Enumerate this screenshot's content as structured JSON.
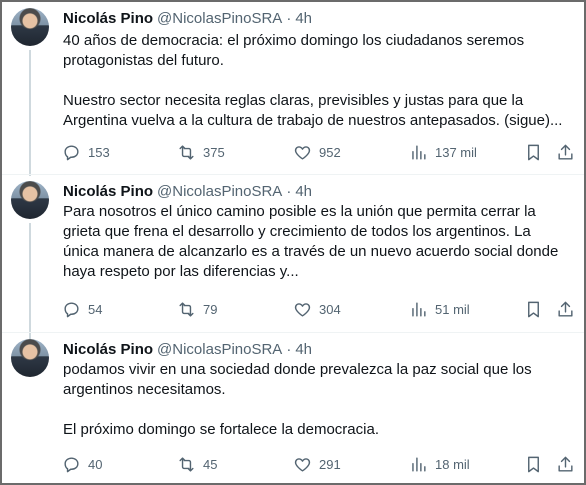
{
  "tweets": [
    {
      "author": {
        "name": "Nicolás Pino",
        "handle": "@NicolasPinoSRA"
      },
      "time": "4h",
      "paragraphs": [
        "40 años de democracia: el próximo domingo los ciudadanos seremos protagonistas del futuro.",
        "Nuestro sector necesita reglas claras, previsibles y justas para que la Argentina vuelva a la cultura de trabajo de nuestros antepasados. (sigue)..."
      ],
      "stats": {
        "replies": "153",
        "retweets": "375",
        "likes": "952",
        "views": "137 mil"
      }
    },
    {
      "author": {
        "name": "Nicolás Pino",
        "handle": "@NicolasPinoSRA"
      },
      "time": "4h",
      "paragraphs": [
        "Para nosotros el único camino posible es la unión que permita cerrar la grieta que frena el desarrollo y crecimiento de todos los argentinos. La única manera de alcanzarlo es a través de un nuevo acuerdo social donde haya respeto por las diferencias y..."
      ],
      "stats": {
        "replies": "54",
        "retweets": "79",
        "likes": "304",
        "views": "51 mil"
      }
    },
    {
      "author": {
        "name": "Nicolás Pino",
        "handle": "@NicolasPinoSRA"
      },
      "time": "4h",
      "paragraphs": [
        "podamos vivir en una sociedad donde prevalezca la paz social que los argentinos necesitamos.",
        "El próximo domingo se fortalece la democracia."
      ],
      "stats": {
        "replies": "40",
        "retweets": "45",
        "likes": "291",
        "views": "18 mil"
      }
    }
  ],
  "icons": {
    "reply": "reply-icon",
    "retweet": "retweet-icon",
    "like": "heart-icon",
    "views": "views-icon",
    "bookmark": "bookmark-icon",
    "share": "share-icon"
  },
  "colors": {
    "text": "#0f1419",
    "secondary": "#536471",
    "thread_line": "#cfd9de"
  }
}
